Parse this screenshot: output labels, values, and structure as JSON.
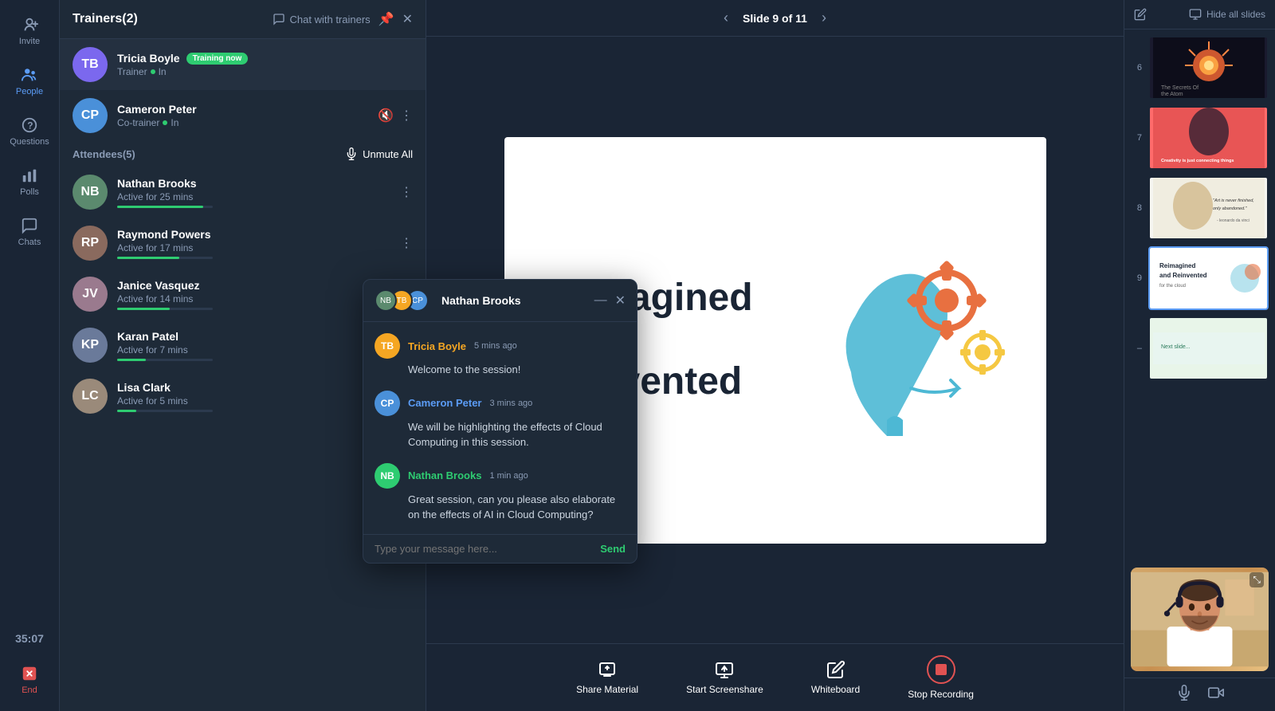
{
  "nav": {
    "invite_label": "Invite",
    "people_label": "People",
    "questions_label": "Questions",
    "polls_label": "Polls",
    "chats_label": "Chats",
    "end_label": "End",
    "timer": "35:07"
  },
  "people_panel": {
    "header_title": "Trainers(2)",
    "chat_with_trainers": "Chat with trainers",
    "trainers": [
      {
        "name": "Tricia Boyle",
        "badge": "Training now",
        "role": "Trainer",
        "status": "In",
        "avatar_initials": "TB",
        "avatar_color": "#7b68ee"
      },
      {
        "name": "Cameron Peter",
        "badge": "",
        "role": "Co-trainer",
        "status": "In",
        "avatar_initials": "CP",
        "avatar_color": "#4a90d9"
      }
    ],
    "attendees_header": "Attendees(5)",
    "unmute_all": "Unmute All",
    "attendees": [
      {
        "name": "Nathan Brooks",
        "activity": "Active for 25 mins",
        "activity_pct": 90,
        "avatar_initials": "NB",
        "avatar_color": "#5b8a6e"
      },
      {
        "name": "Raymond Powers",
        "activity": "Active for 17 mins",
        "activity_pct": 65,
        "avatar_initials": "RP",
        "avatar_color": "#8a6a5e"
      },
      {
        "name": "Janice Vasquez",
        "activity": "Active for 14 mins",
        "activity_pct": 55,
        "avatar_initials": "JV",
        "avatar_color": "#9a7a8e"
      },
      {
        "name": "Karan Patel",
        "activity": "Active for 7 mins",
        "activity_pct": 30,
        "avatar_initials": "KP",
        "avatar_color": "#6a7a9a"
      },
      {
        "name": "Lisa Clark",
        "activity": "Active for 5 mins",
        "activity_pct": 20,
        "avatar_initials": "LC",
        "avatar_color": "#9a8a7a"
      }
    ]
  },
  "slide_nav": {
    "current": "Slide 9 of 11",
    "prev_label": "‹",
    "next_label": "›"
  },
  "slides": {
    "hide_label": "Hide all slides",
    "thumbnails": [
      {
        "number": "6",
        "type": "dark",
        "label": "The Secrets Of The Atom"
      },
      {
        "number": "7",
        "type": "red",
        "label": "Creativity quote"
      },
      {
        "number": "8",
        "type": "light",
        "label": "Art is never finished"
      },
      {
        "number": "9",
        "type": "white",
        "label": "Reimagined and Reinvented for the cloud",
        "active": true
      }
    ]
  },
  "toolbar": {
    "share_material": "Share Material",
    "start_screenshare": "Start Screenshare",
    "whiteboard": "Whiteboard",
    "stop_recording": "Stop Recording"
  },
  "chat_modal": {
    "title": "Nathan Brooks",
    "messages": [
      {
        "sender": "Tricia Boyle",
        "sender_class": "tricia",
        "time": "5 mins ago",
        "text": "Welcome to the session!",
        "initials": "TB",
        "color": "#f5a623"
      },
      {
        "sender": "Cameron Peter",
        "sender_class": "cameron",
        "time": "3 mins ago",
        "text": "We will be highlighting the effects of Cloud Computing in this session.",
        "initials": "CP",
        "color": "#4a90d9"
      },
      {
        "sender": "Nathan Brooks",
        "sender_class": "nathan",
        "time": "1 min ago",
        "text": "Great session, can you please also elaborate on the effects of AI in Cloud Computing?",
        "initials": "NB",
        "color": "#2ecc71"
      }
    ],
    "input_placeholder": "Type your message here...",
    "send_label": "Send"
  }
}
